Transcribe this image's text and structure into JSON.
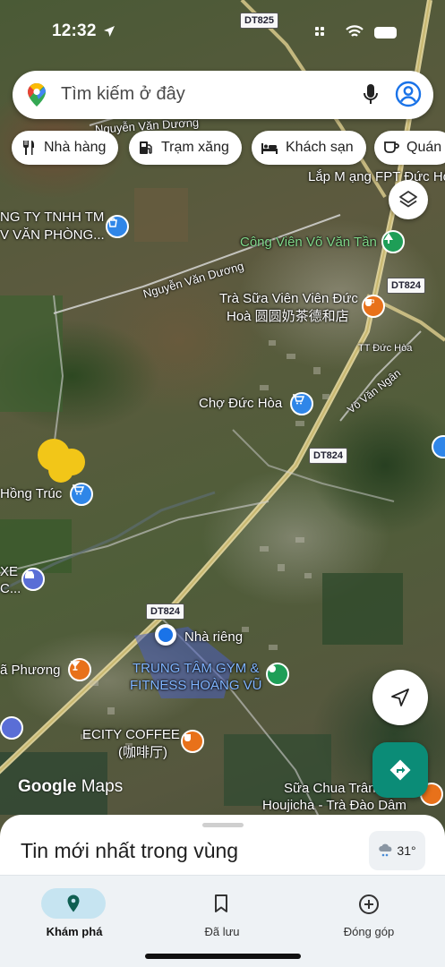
{
  "status_bar": {
    "time": "12:32"
  },
  "search": {
    "placeholder": "Tìm kiếm ở đây"
  },
  "chips": [
    {
      "label": "Nhà hàng",
      "icon": "restaurant-icon"
    },
    {
      "label": "Trạm xăng",
      "icon": "gas-station-icon"
    },
    {
      "label": "Khách sạn",
      "icon": "hotel-icon"
    },
    {
      "label": "Quán",
      "icon": "cafe-icon"
    }
  ],
  "map": {
    "roads": [
      "DT825",
      "DT824",
      "DT824",
      "DT824"
    ],
    "labels": {
      "nguyen_van_duong_1": "Nguyễn Văn Dương",
      "nguyen_van_duong_2": "Nguyễn Văn Dương",
      "lap_mang": "Lắp M ạng FPT Đức Hò",
      "cong_ty_1": "NG TY TNHH TM",
      "cong_ty_2": "V VĂN PHÒNG...",
      "cong_vien": "Công Viên Võ Văn Tần",
      "tra_sua_1": "Trà Sữa Viên Viên Đức",
      "tra_sua_2": "Hoà 圆圆奶茶德和店",
      "tt_duc_hoa": "TT Đức Hòa",
      "vo_van_ngan": "Võ Văn Ngân",
      "cho_duc_hoa": "Chợ Đức Hòa",
      "hong_truc": "Hồng Trúc",
      "xe_1": "XE",
      "xe_2": "C...",
      "nha_rieng": "Nhà riêng",
      "gym_1": "TRUNG TÂM GYM &",
      "gym_2": "FITNESS HOÀNG VŨ",
      "a_phuong": "ã Phương",
      "ecity_1": "ECITY COFFEE",
      "ecity_2": "(咖啡厅)",
      "sua_chua_1": "Sữa Chua Trân",
      "sua_chua_2": "Houjicha - Trà Đào Dâm"
    },
    "google_logo": {
      "word1": "Google",
      "word2": "Maps"
    }
  },
  "sheet": {
    "title": "Tin mới nhất trong vùng",
    "temperature": "31°"
  },
  "nav": [
    {
      "label": "Khám phá",
      "icon": "explore-pin-icon",
      "active": true
    },
    {
      "label": "Đã lưu",
      "icon": "bookmark-icon",
      "active": false
    },
    {
      "label": "Đóng góp",
      "icon": "add-circle-icon",
      "active": false
    }
  ],
  "colors": {
    "accent": "#0b8c77",
    "active_pill": "#c6e4f1",
    "poi_blue": "#2f86e8",
    "poi_orange": "#e8711a",
    "poi_green": "#1e9e57"
  }
}
